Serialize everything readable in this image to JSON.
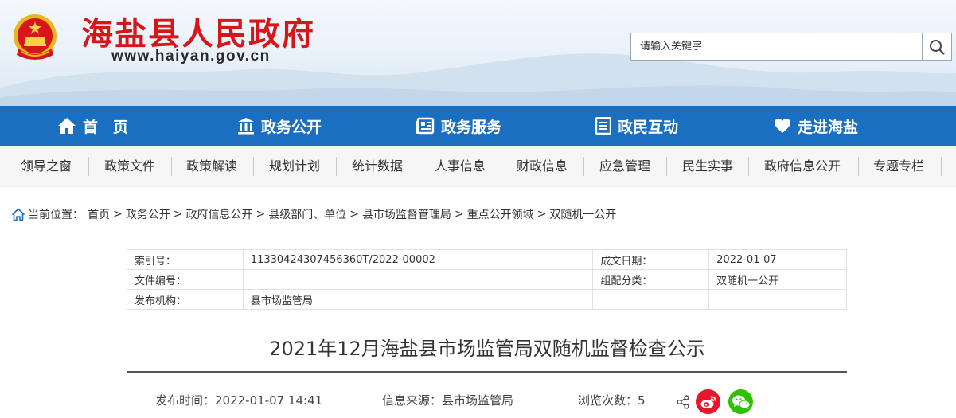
{
  "header": {
    "site_title": "海盐县人民政府",
    "site_url": "www.haiyan.gov.cn",
    "search_placeholder": "请输入关键字"
  },
  "main_nav": [
    {
      "label": "首　页",
      "icon": "home-icon"
    },
    {
      "label": "政务公开",
      "icon": "building-icon"
    },
    {
      "label": "政务服务",
      "icon": "newspaper-icon"
    },
    {
      "label": "政民互动",
      "icon": "list-icon"
    },
    {
      "label": "走进海盐",
      "icon": "heart-icon"
    }
  ],
  "sub_nav": [
    "领导之窗",
    "政策文件",
    "政策解读",
    "规划计划",
    "统计数据",
    "人事信息",
    "财政信息",
    "应急管理",
    "民生实事",
    "政府信息公开",
    "专题专栏"
  ],
  "breadcrumb": {
    "prefix": "当前位置：",
    "items": [
      "首页",
      "政务公开",
      "政府信息公开",
      "县级部门、单位",
      "县市场监督管理局",
      "重点公开领域",
      "双随机一公开"
    ],
    "separator": ">"
  },
  "meta": {
    "index_label": "索引号：",
    "index_value": "11330424307456360T/2022-00002",
    "date_label": "成文日期：",
    "date_value": "2022-01-07",
    "docno_label": "文件编号：",
    "docno_value": "",
    "category_label": "组配分类：",
    "category_value": "双随机一公开",
    "publisher_label": "发布机构：",
    "publisher_value": "县市场监管局"
  },
  "article": {
    "title": "2021年12月海盐县市场监管局双随机监督检查公示",
    "publish_time": "发布时间：2022-01-07 14:41",
    "source": "信息来源：县市场监管局",
    "views": "浏览次数：5"
  },
  "colors": {
    "title_red": "#d7161b",
    "nav_blue": "#1a6fc1",
    "weibo_red": "#e6162d",
    "wechat_green": "#2dc100"
  },
  "icons": [
    "national-emblem",
    "search-icon",
    "home-outline-icon",
    "share-icon",
    "weibo-icon",
    "wechat-icon"
  ]
}
